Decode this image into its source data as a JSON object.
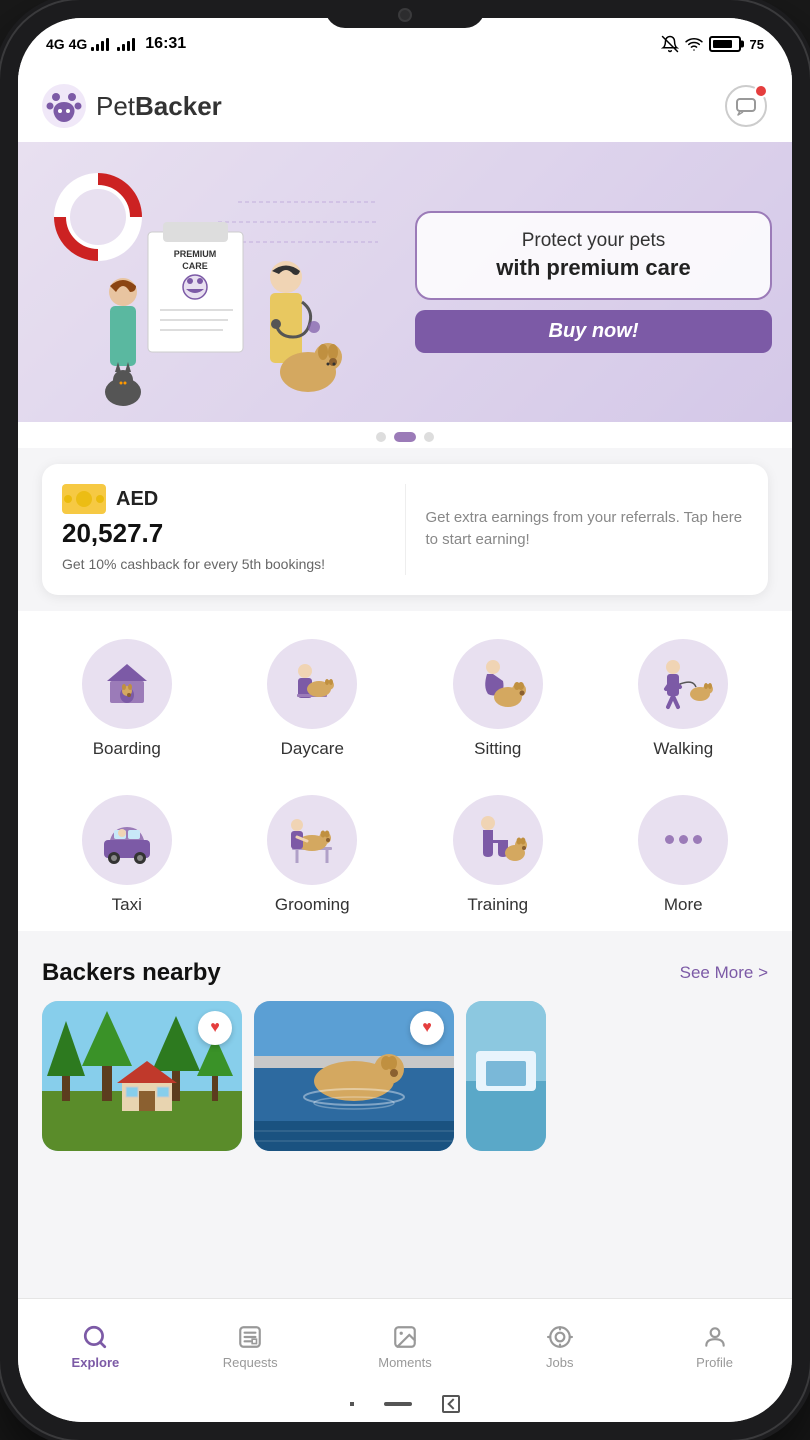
{
  "status_bar": {
    "network1": "4G",
    "network2": "4G",
    "time": "16:31",
    "battery_level": "75"
  },
  "header": {
    "logo_text_regular": "Pet",
    "logo_text_bold": "Backer",
    "chat_button_label": "Chat"
  },
  "banner": {
    "line1": "Protect your pets",
    "line2": "with premium care",
    "cta": "Buy now!",
    "slide_count": 3,
    "active_slide": 1
  },
  "earnings": {
    "currency": "AED",
    "amount": "20,527.7",
    "cashback_note": "Get 10% cashback for every 5th bookings!",
    "referral_text": "Get extra earnings from your referrals. Tap here to start earning!"
  },
  "services": {
    "row1": [
      {
        "id": "boarding",
        "label": "Boarding"
      },
      {
        "id": "daycare",
        "label": "Daycare"
      },
      {
        "id": "sitting",
        "label": "Sitting"
      },
      {
        "id": "walking",
        "label": "Walking"
      }
    ],
    "row2": [
      {
        "id": "taxi",
        "label": "Taxi"
      },
      {
        "id": "grooming",
        "label": "Grooming"
      },
      {
        "id": "training",
        "label": "Training"
      },
      {
        "id": "more",
        "label": "More"
      }
    ]
  },
  "backers_section": {
    "title": "Backers nearby",
    "see_more": "See More >"
  },
  "nav": {
    "items": [
      {
        "id": "explore",
        "label": "Explore",
        "active": true
      },
      {
        "id": "requests",
        "label": "Requests",
        "active": false
      },
      {
        "id": "moments",
        "label": "Moments",
        "active": false
      },
      {
        "id": "jobs",
        "label": "Jobs",
        "active": false
      },
      {
        "id": "profile",
        "label": "Profile",
        "active": false
      }
    ]
  }
}
